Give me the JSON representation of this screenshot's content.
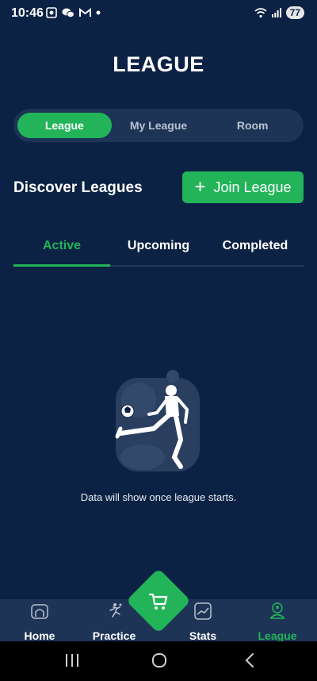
{
  "status_bar": {
    "time": "10:46",
    "battery": "77"
  },
  "header": {
    "title": "LEAGUE"
  },
  "segments": [
    {
      "label": "League",
      "active": true
    },
    {
      "label": "My League",
      "active": false
    },
    {
      "label": "Room",
      "active": false
    }
  ],
  "discover": {
    "title": "Discover Leagues",
    "join_label": "Join League",
    "join_icon": "plus-icon"
  },
  "tabs": [
    {
      "label": "Active",
      "active": true
    },
    {
      "label": "Upcoming",
      "active": false
    },
    {
      "label": "Completed",
      "active": false
    }
  ],
  "empty_state": {
    "message": "Data will show once league starts.",
    "icon": "footballer-kick-illustration"
  },
  "bottom_nav": {
    "items": [
      {
        "label": "Home",
        "icon": "home-icon"
      },
      {
        "label": "Practice",
        "icon": "player-kick-icon"
      },
      {
        "label": "Stats",
        "icon": "stats-chart-icon"
      },
      {
        "label": "League",
        "icon": "trophy-ball-icon",
        "active": true
      }
    ],
    "center_button_icon": "cart-icon"
  },
  "colors": {
    "background": "#0c2244",
    "surface": "#1d3456",
    "accent": "#23b45a"
  }
}
